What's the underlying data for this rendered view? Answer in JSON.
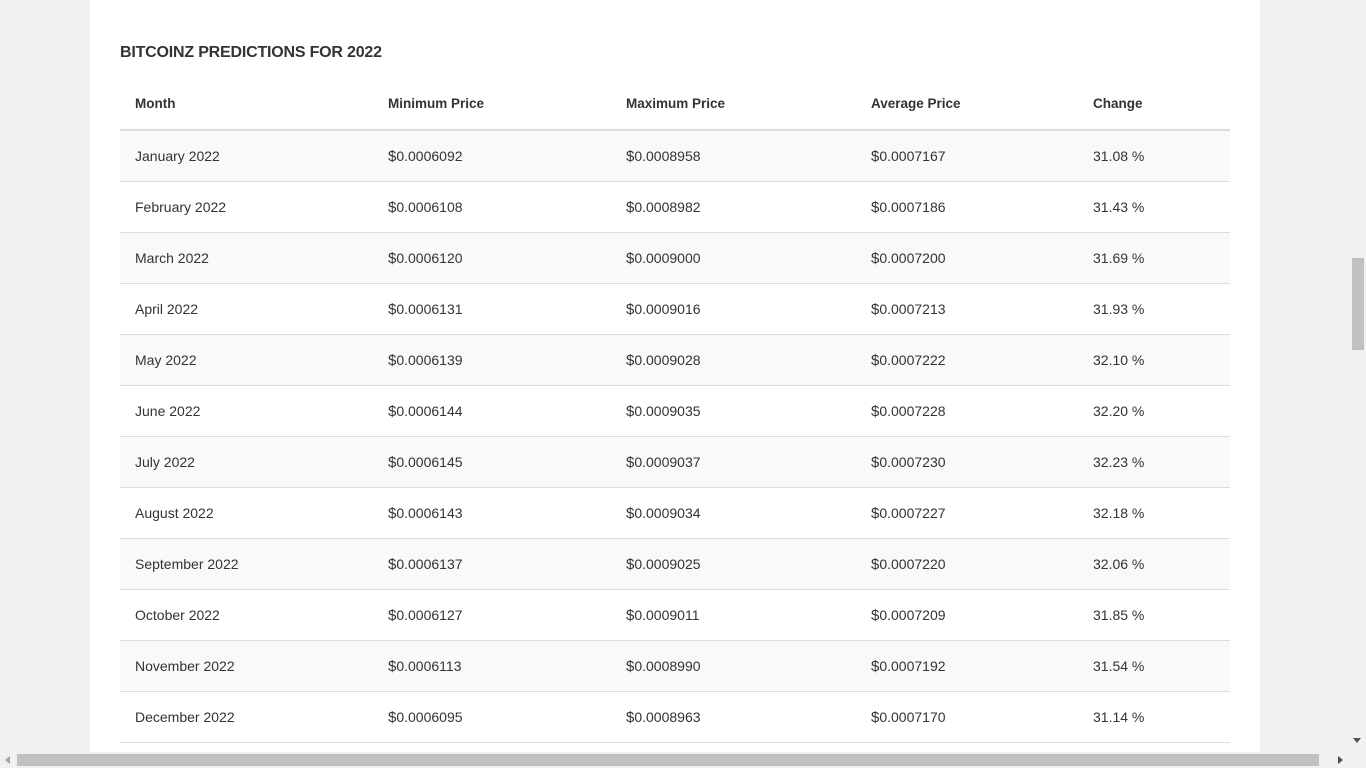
{
  "section_title": "BITCOINZ PREDICTIONS FOR 2022",
  "table": {
    "headers": {
      "month": "Month",
      "min": "Minimum Price",
      "max": "Maximum Price",
      "avg": "Average Price",
      "change": "Change"
    },
    "currency_symbol": "$",
    "rows": [
      {
        "month": "January 2022",
        "min": "0.0006092",
        "max": "0.0008958",
        "avg": "0.0007167",
        "change": "31.08 %"
      },
      {
        "month": "February 2022",
        "min": "0.0006108",
        "max": "0.0008982",
        "avg": "0.0007186",
        "change": "31.43 %"
      },
      {
        "month": "March 2022",
        "min": "0.0006120",
        "max": "0.0009000",
        "avg": "0.0007200",
        "change": "31.69 %"
      },
      {
        "month": "April 2022",
        "min": "0.0006131",
        "max": "0.0009016",
        "avg": "0.0007213",
        "change": "31.93 %"
      },
      {
        "month": "May 2022",
        "min": "0.0006139",
        "max": "0.0009028",
        "avg": "0.0007222",
        "change": "32.10 %"
      },
      {
        "month": "June 2022",
        "min": "0.0006144",
        "max": "0.0009035",
        "avg": "0.0007228",
        "change": "32.20 %"
      },
      {
        "month": "July 2022",
        "min": "0.0006145",
        "max": "0.0009037",
        "avg": "0.0007230",
        "change": "32.23 %"
      },
      {
        "month": "August 2022",
        "min": "0.0006143",
        "max": "0.0009034",
        "avg": "0.0007227",
        "change": "32.18 %"
      },
      {
        "month": "September 2022",
        "min": "0.0006137",
        "max": "0.0009025",
        "avg": "0.0007220",
        "change": "32.06 %"
      },
      {
        "month": "October 2022",
        "min": "0.0006127",
        "max": "0.0009011",
        "avg": "0.0007209",
        "change": "31.85 %"
      },
      {
        "month": "November 2022",
        "min": "0.0006113",
        "max": "0.0008990",
        "avg": "0.0007192",
        "change": "31.54 %"
      },
      {
        "month": "December 2022",
        "min": "0.0006095",
        "max": "0.0008963",
        "avg": "0.0007170",
        "change": "31.14 %"
      }
    ]
  }
}
